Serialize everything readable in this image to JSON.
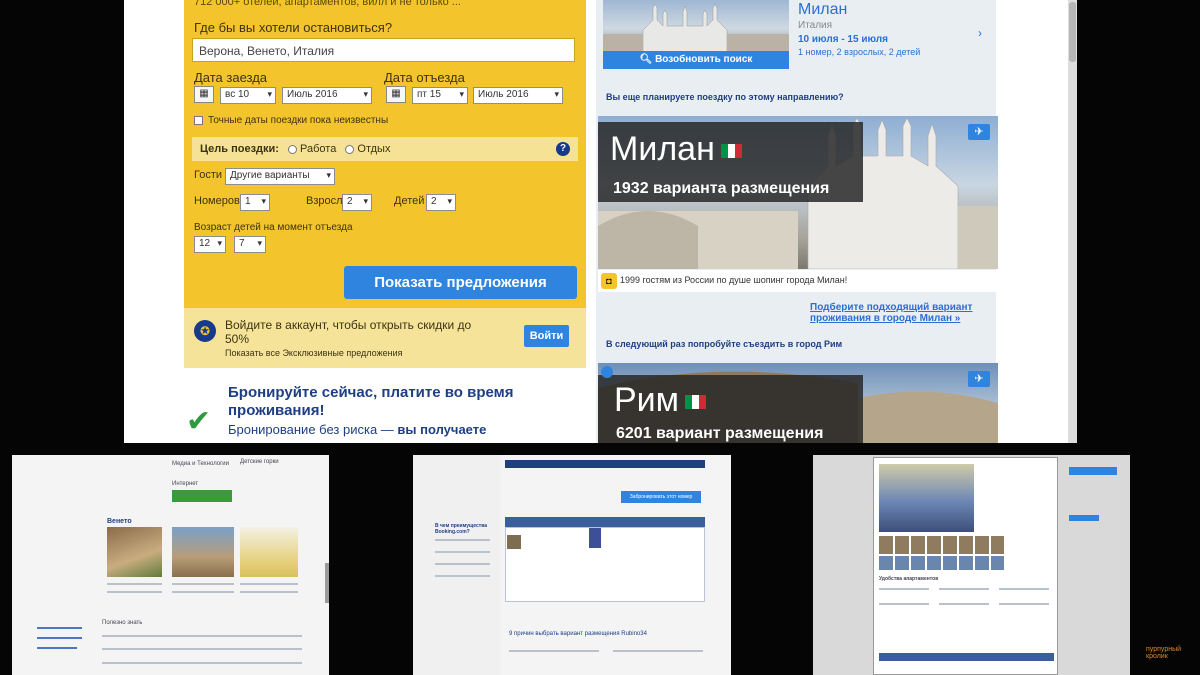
{
  "search_panel": {
    "top_text": "712 000+ отелей, апартаментов, вилл и не только ...",
    "where_label": "Где бы вы хотели остановиться?",
    "destination_value": "Верона, Венето, Италия",
    "checkin_label": "Дата заезда",
    "checkin_day": "вс 10",
    "checkin_month": "Июль 2016",
    "checkout_label": "Дата отъезда",
    "checkout_day": "пт 15",
    "checkout_month": "Июль 2016",
    "flexible_dates": "Точные даты поездки пока неизвестны",
    "purpose_label": "Цель поездки:",
    "purpose_work": "Работа",
    "purpose_leisure": "Отдых",
    "guests_label": "Гости",
    "guests_value": "Другие варианты",
    "rooms_label": "Номеров",
    "rooms_value": "1",
    "adults_label": "Взрослых",
    "adults_value": "2",
    "children_label": "Детей",
    "children_value": "2",
    "child_age_label": "Возраст детей на момент отъезда",
    "child_age_1": "12",
    "child_age_2": "7",
    "show_button": "Показать предложения"
  },
  "login_box": {
    "title": "Войдите в аккаунт, чтобы открыть скидки до 50%",
    "subtitle": "Показать все Эксклюзивные предложения",
    "button": "Войти"
  },
  "promo": {
    "title": "Бронируйте сейчас, платите во время проживания!",
    "subtitle_start": "Бронирование без риска — ",
    "subtitle_bold": "вы получаете"
  },
  "recent_search": {
    "city": "Милан",
    "country": "Италия",
    "dates": "10 июля - 15 июля",
    "details": "1 номер, 2 взрослых, 2 детей",
    "resume_button": "Возобновить поиск"
  },
  "milan_section": {
    "heading": "Вы еще планируете поездку по этому направлению?",
    "city": "Милан",
    "count": "1932 варианта размещения",
    "note": "1999 гостям из России по душе шопинг города Милан!",
    "link": "Подберите подходящий вариант проживания в городе Милан »"
  },
  "rome_section": {
    "heading": "В следующий раз попробуйте съездить в город Рим",
    "city": "Рим",
    "count": "6201 вариант размещения"
  },
  "thumb1": {
    "region": "Венето",
    "cat1": "Медиа и Технологии",
    "cat2": "Детские горки",
    "internet": "Интернет",
    "good_to_know": "Полезно знать"
  },
  "thumb2": {
    "book_button": "Забронировать этот номер",
    "why_book": "В чем преимущества Booking.com?",
    "choose": "9 причин выбрать вариант размещения Rubino34"
  },
  "thumb3": {
    "title": "Удобства апартаментов"
  },
  "watermark": "пурпурный кролик",
  "colors": {
    "booking_yellow": "#f3c42b",
    "booking_blue": "#2f84e0",
    "link_blue": "#2a6fd4",
    "dark_blue": "#003580"
  }
}
